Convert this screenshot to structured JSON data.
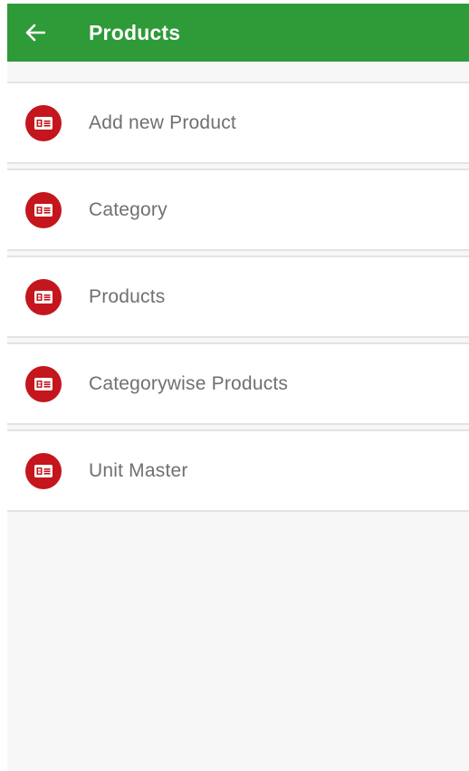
{
  "header": {
    "title": "Products",
    "back_icon": "arrow-left-icon",
    "background_color": "#2e9a38"
  },
  "menu": {
    "icon": "id-card-icon",
    "icon_color": "#c4161c",
    "items": [
      {
        "label": "Add new Product"
      },
      {
        "label": "Category"
      },
      {
        "label": "Products"
      },
      {
        "label": "Categorywise Products"
      },
      {
        "label": "Unit Master"
      }
    ]
  }
}
